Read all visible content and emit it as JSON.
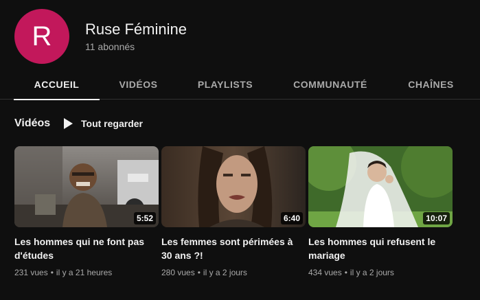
{
  "channel": {
    "avatar_letter": "R",
    "avatar_color": "#c2185b",
    "name": "Ruse Féminine",
    "subscribers": "11 abonnés"
  },
  "tabs": [
    {
      "label": "ACCUEIL",
      "active": true
    },
    {
      "label": "VIDÉOS",
      "active": false
    },
    {
      "label": "PLAYLISTS",
      "active": false
    },
    {
      "label": "COMMUNAUTÉ",
      "active": false
    },
    {
      "label": "CHAÎNES",
      "active": false
    }
  ],
  "section": {
    "title": "Vidéos",
    "play_all_icon": "play-icon",
    "play_all_label": "Tout regarder"
  },
  "videos": [
    {
      "title": "Les hommes qui ne font pas d'études",
      "duration": "5:52",
      "views": "231 vues",
      "age": "il y a 21 heures"
    },
    {
      "title": "Les femmes sont périmées à 30 ans ?!",
      "duration": "6:40",
      "views": "280 vues",
      "age": "il y a 2 jours"
    },
    {
      "title": "Les hommes qui refusent le mariage",
      "duration": "10:07",
      "views": "434 vues",
      "age": "il y a 2 jours"
    }
  ],
  "meta_separator": "•"
}
